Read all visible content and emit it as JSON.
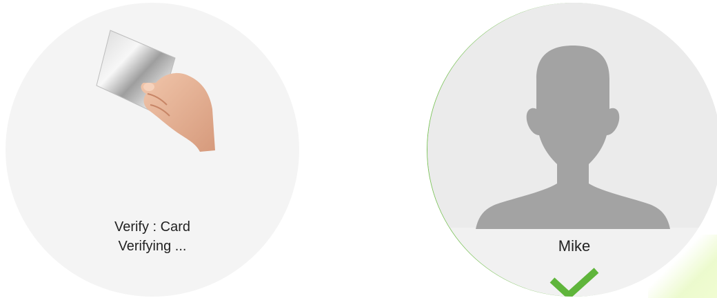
{
  "left_panel": {
    "verify_mode": "Verify : Card",
    "verify_status": "Verifying ...",
    "illustration_icon": "hand-holding-card-icon"
  },
  "right_panel": {
    "user_name": "Mike",
    "avatar_icon": "user-silhouette-icon",
    "result_icon": "checkmark-icon",
    "result_color": "#5fb53b"
  },
  "colors": {
    "panel_bg": "#f4f4f4",
    "avatar_bg": "#ebebeb",
    "silhouette": "#a3a3a3",
    "success_green": "#5fb53b"
  }
}
